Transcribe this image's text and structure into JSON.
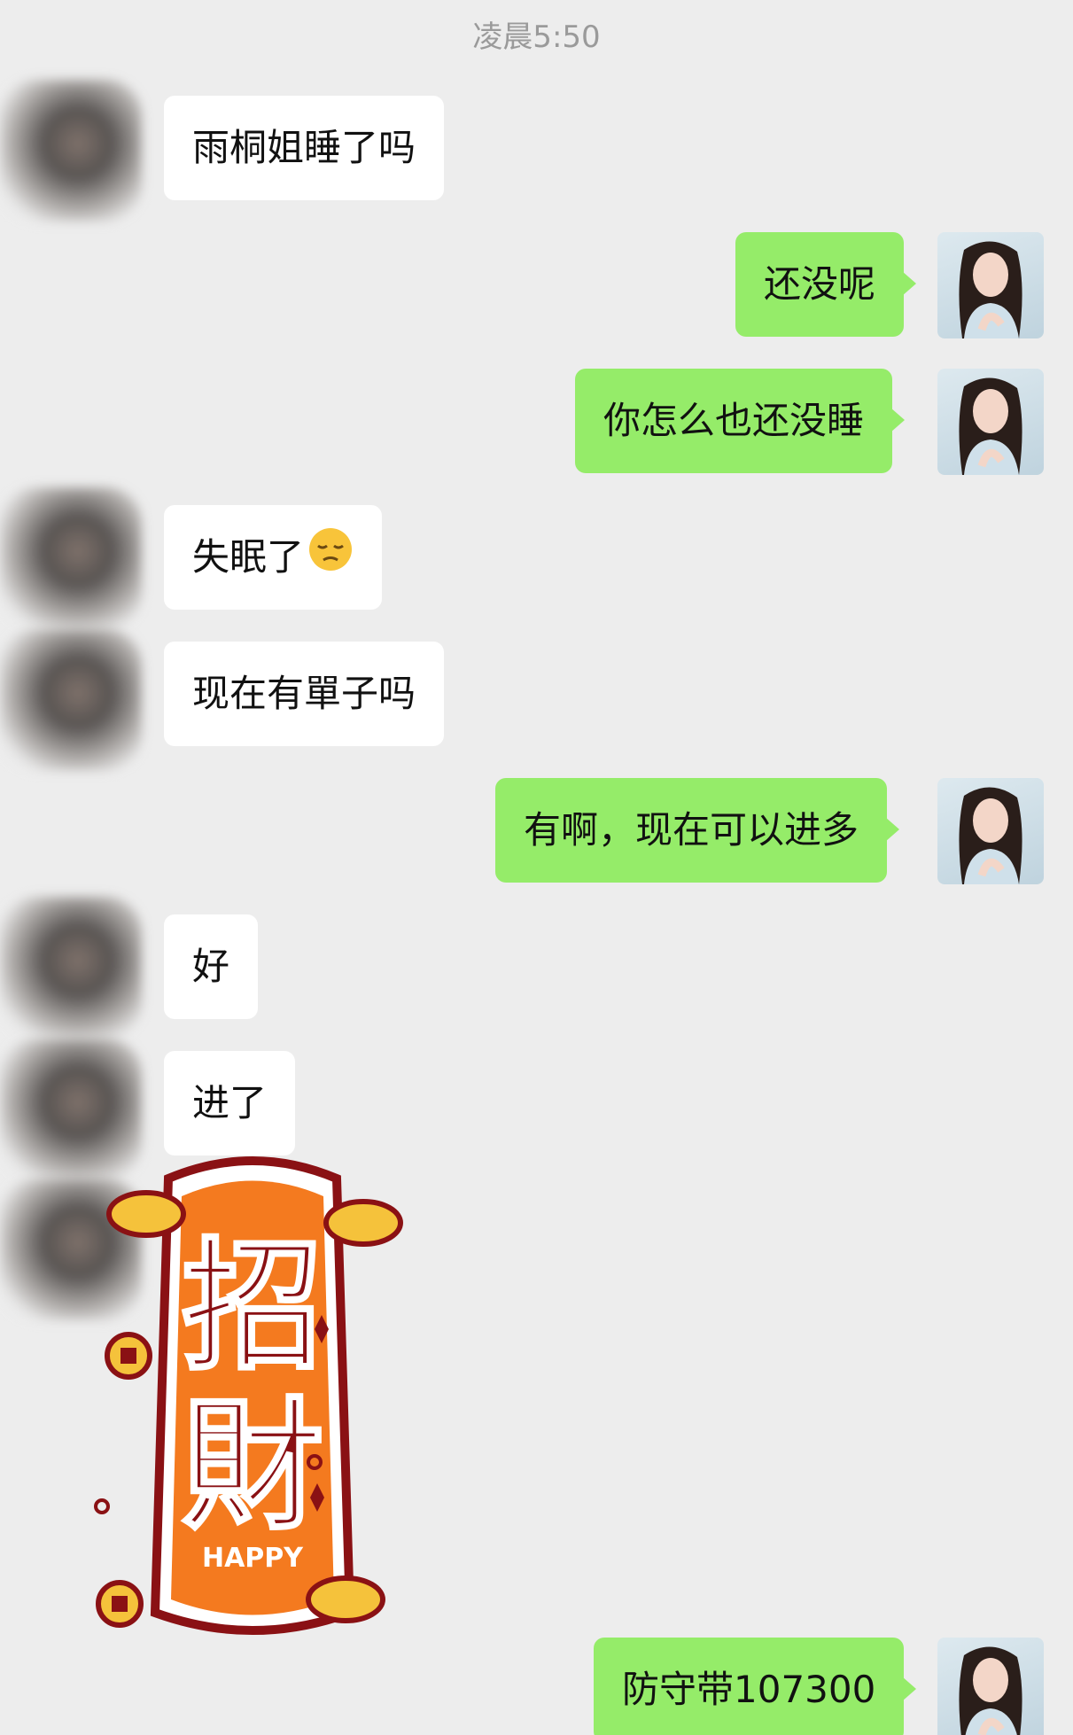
{
  "timestamp": "凌晨5:50",
  "messages": [
    {
      "side": "left",
      "text": "雨桐姐睡了吗"
    },
    {
      "side": "right",
      "text": "还没呢"
    },
    {
      "side": "right",
      "text": "你怎么也还没睡"
    },
    {
      "side": "left",
      "text": "失眠了"
    },
    {
      "side": "left",
      "text": "现在有單子吗"
    },
    {
      "side": "right",
      "text": "有啊，现在可以进多"
    },
    {
      "side": "left",
      "text": "好"
    },
    {
      "side": "left",
      "text": "进了"
    },
    {
      "side": "right",
      "text": "防守带107300"
    }
  ],
  "emoji_name": "pensive-face",
  "sticker": {
    "big_text_1": "招",
    "big_text_2": "財",
    "small_text": "HAPPY"
  },
  "colors": {
    "background": "#ededed",
    "my_bubble": "#95ec69",
    "their_bubble": "#ffffff",
    "sticker_orange": "#f47a1f",
    "sticker_dark_red": "#8a1114",
    "gold": "#f5c23b"
  }
}
